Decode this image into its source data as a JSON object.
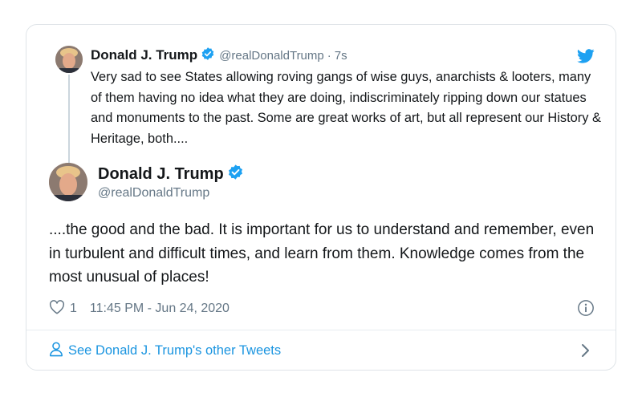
{
  "quoted_tweet": {
    "name": "Donald J. Trump",
    "handle": "@realDonaldTrump",
    "separator": "·",
    "time": "7s",
    "text": "Very sad to see States allowing roving gangs of wise guys, anarchists & looters, many of them having no idea what they are doing, indiscriminately ripping down our statues and monuments to the past. Some are great works of art, but all represent our History & Heritage, both...."
  },
  "main_tweet": {
    "name": "Donald J. Trump",
    "handle": "@realDonaldTrump",
    "text": "....the good and the bad. It is important for us to understand and remember, even in turbulent and difficult times, and learn from them. Knowledge comes from the most unusual of places!",
    "likes": "1",
    "timestamp": "11:45 PM - Jun 24, 2020"
  },
  "footer": {
    "label": "See Donald J. Trump's other Tweets"
  },
  "icons": {
    "verified": "verified-badge-icon",
    "bird": "twitter-bird-icon",
    "heart": "heart-icon",
    "info": "info-icon",
    "person": "person-icon",
    "chevron": "chevron-right-icon"
  },
  "colors": {
    "accent": "#1da1f2",
    "link": "#1b95e0",
    "muted": "#657786",
    "text": "#14171a",
    "border": "#dfe4e8"
  }
}
